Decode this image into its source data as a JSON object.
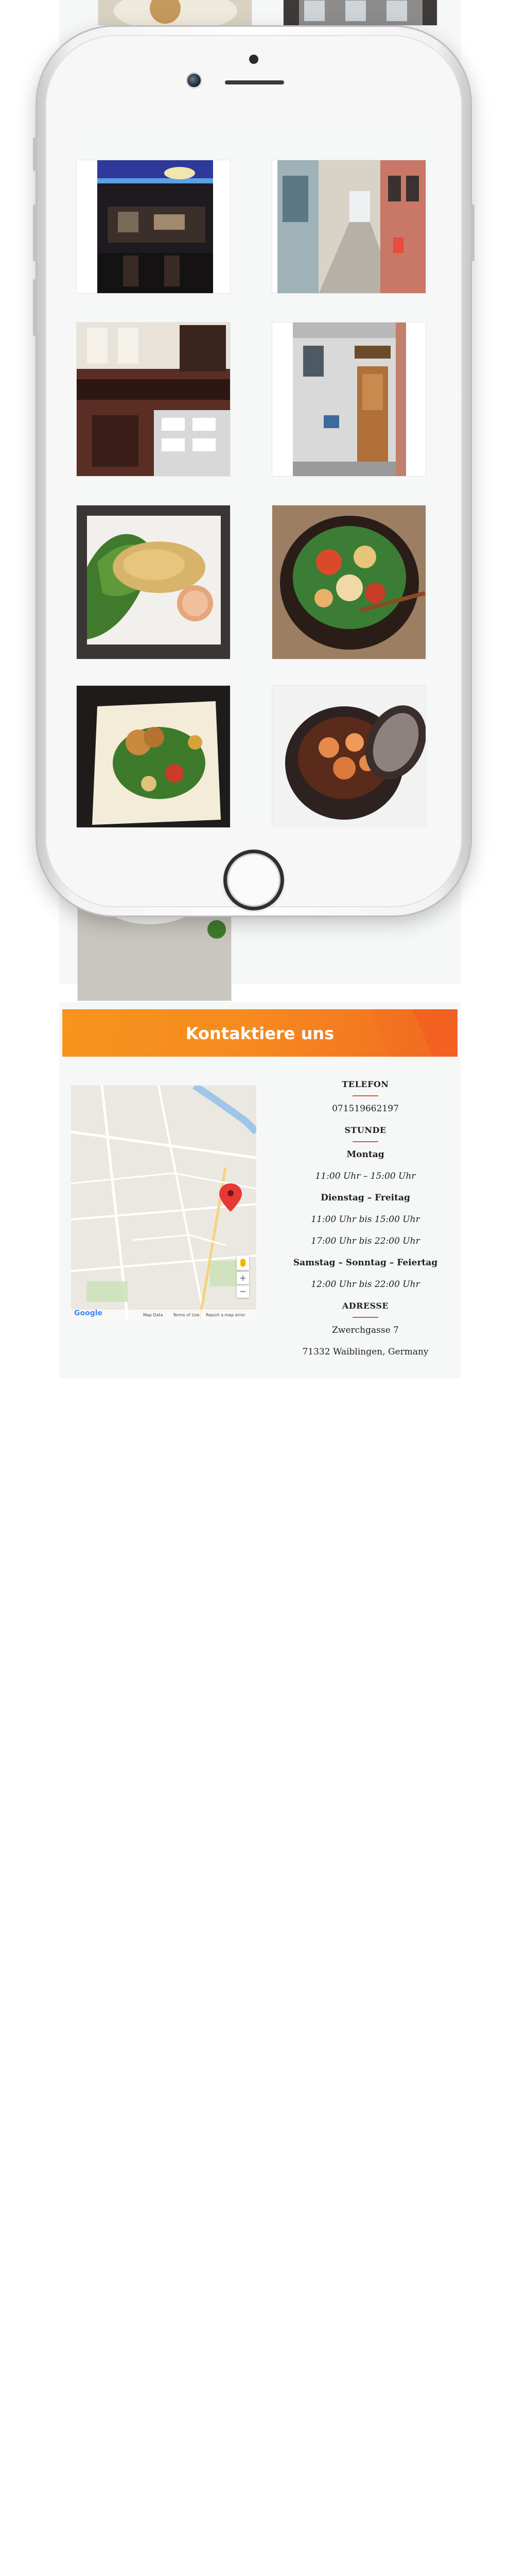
{
  "gallery": {
    "photos": [
      {
        "name": "restaurant-interior-blue-lights",
        "visible": true
      },
      {
        "name": "street-alley",
        "visible": true
      },
      {
        "name": "restaurant-dining-room",
        "visible": true
      },
      {
        "name": "restaurant-entrance",
        "visible": true
      },
      {
        "name": "vegetable-pancake-dish",
        "visible": true
      },
      {
        "name": "stir-fry-bowl",
        "visible": true
      },
      {
        "name": "salad-plate",
        "visible": true
      },
      {
        "name": "shrimp-clay-pot",
        "visible": true
      },
      {
        "name": "soup-bowl",
        "visible": true
      }
    ]
  },
  "device": {
    "type": "iphone-mockup",
    "color": "#ffffff"
  },
  "contact": {
    "title": "Kontaktiere uns",
    "accent_color": "#f26522",
    "map": {
      "google_label": "Google",
      "map_data": "Map Data",
      "terms": "Terms of Use",
      "report": "Report a map error",
      "zoom_in": "+",
      "zoom_out": "−"
    },
    "phone_heading": "TELEFON",
    "phone": "071519662197",
    "hours_heading": "STUNDE",
    "monday": "Montag",
    "monday_hours": "11:00 Uhr – 15:00 Uhr",
    "tue_fri": "Dienstag – Freitag",
    "tue_fri_lunch": "11:00 Uhr bis 15:00 Uhr",
    "tue_fri_dinner": "17:00 Uhr bis 22:00 Uhr",
    "weekend": "Samstag – Sonntag – Feiertag",
    "weekend_hours": "12:00 Uhr bis 22:00 Uhr",
    "address_heading": "ADRESSE",
    "street": "Zwerchgasse 7",
    "city": "71332 Waiblingen, Germany"
  }
}
